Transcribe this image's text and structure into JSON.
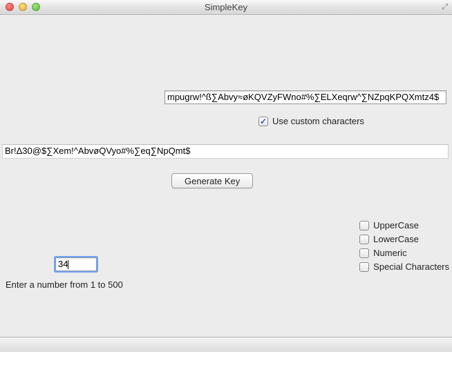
{
  "window": {
    "title": "SimpleKey"
  },
  "customChars": {
    "value": "mpugrw!^ß∑Abvy≈øKQVZyFWno#%∑ELXeqrw^∑NZpqKPQXmtz4$",
    "useCustom": {
      "label": "Use custom characters",
      "checked": true
    }
  },
  "output": {
    "value": "Br!Δ30@$∑Xem!^AbvøQVyo#%∑eq∑NpQmt$"
  },
  "actions": {
    "generate": "Generate Key"
  },
  "options": {
    "uppercase": {
      "label": "UpperCase",
      "checked": false
    },
    "lowercase": {
      "label": "LowerCase",
      "checked": false
    },
    "numeric": {
      "label": "Numeric",
      "checked": false
    },
    "special": {
      "label": "Special Characters",
      "checked": false
    }
  },
  "length": {
    "value": "34",
    "hint": "Enter a number from 1 to 500"
  }
}
